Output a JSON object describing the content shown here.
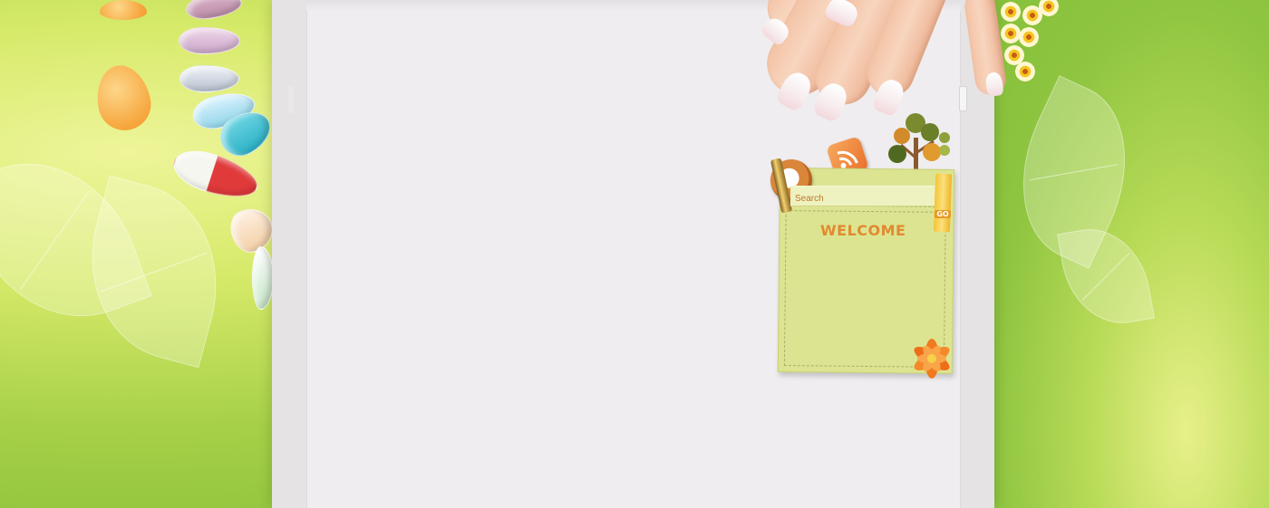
{
  "search": {
    "placeholder": "Search"
  },
  "widget": {
    "title": "WELCOME",
    "go_label": "GO"
  },
  "icons": {
    "rss": "rss-icon",
    "tree": "tree-icon",
    "badge": "badge-icon",
    "pen": "pen-icon",
    "flower": "orange-flower-icon"
  },
  "colors": {
    "background_green": "#8bc23b",
    "content_bg": "#efedef",
    "frame_bg": "#e5e3e4",
    "widget_bg": "#dde491",
    "welcome_text": "#e08a30",
    "search_text": "#c0752e"
  }
}
